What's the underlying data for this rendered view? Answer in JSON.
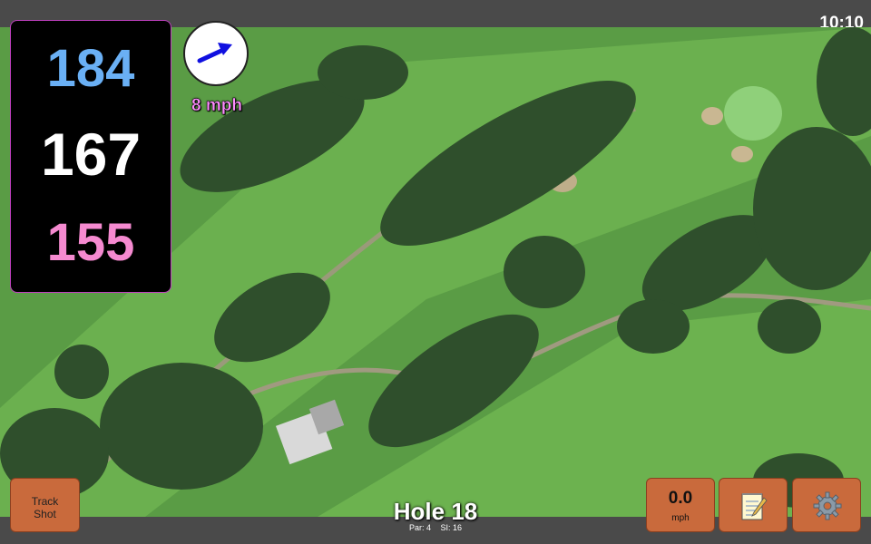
{
  "status": {
    "time": "10:10"
  },
  "distances": {
    "back": "184",
    "middle": "167",
    "front": "155",
    "colors": {
      "back": "#6ab0f5",
      "middle": "#ffffff",
      "front": "#f58ad0"
    }
  },
  "wind": {
    "speed_label": "8 mph",
    "direction_icon": "arrow-icon",
    "arrow_color": "#1010e0"
  },
  "track_shot": {
    "label": "Track\nShot"
  },
  "speed": {
    "value": "0.0",
    "unit": "mph"
  },
  "notes": {
    "icon": "notepad-icon"
  },
  "settings": {
    "icon": "gear-icon"
  },
  "hole": {
    "title": "Hole 18",
    "par": "Par: 4",
    "si": "SI: 16"
  },
  "colors": {
    "button": "#c96a3c",
    "bar": "#4a4a4a"
  }
}
